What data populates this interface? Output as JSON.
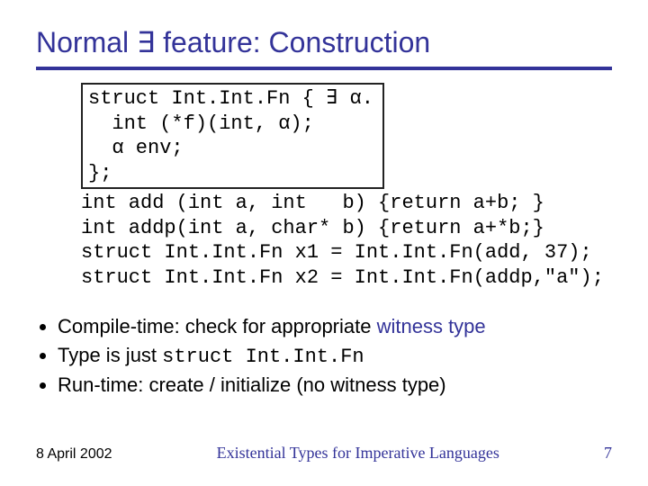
{
  "title": "Normal ∃ feature: Construction",
  "code": {
    "box_line1": "struct Int.Int.Fn { ∃ α.",
    "box_line2": "  int (*f)(int, α);",
    "box_line3": "  α env;",
    "box_line4": "};",
    "line5": "int add (int a, int   b) {return a+b; }",
    "line6": "int addp(int a, char* b) {return a+*b;}",
    "line7": "struct Int.Int.Fn x1 = Int.Int.Fn(add, 37);",
    "line8": "struct Int.Int.Fn x2 = Int.Int.Fn(addp,\"a\");"
  },
  "bullets": {
    "b1_prefix": "Compile-time: check for appropriate ",
    "b1_witness": "witness type",
    "b2_prefix": "Type is just ",
    "b2_code": "struct Int.Int.Fn",
    "b3": "Run-time: create / initialize (no witness type)"
  },
  "footer": {
    "date": "8 April 2002",
    "center": "Existential Types for Imperative Languages",
    "page": "7"
  }
}
